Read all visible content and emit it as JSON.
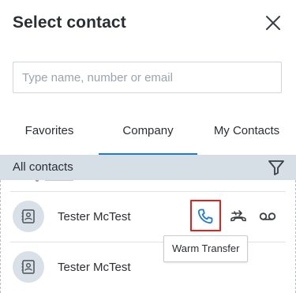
{
  "dialog": {
    "title": "Select contact"
  },
  "search": {
    "placeholder": "Type name, number or email",
    "value": ""
  },
  "tabs": [
    {
      "label": "Favorites",
      "active": false
    },
    {
      "label": "Company",
      "active": true
    },
    {
      "label": "My Contacts",
      "active": false
    }
  ],
  "section": {
    "label": "All contacts"
  },
  "contacts": [
    {
      "name": "Tester McTest",
      "avatar_icon": "contact-card-icon"
    },
    {
      "name": "Tester McTest",
      "avatar_icon": "contact-card-icon"
    }
  ],
  "actions": {
    "call_icon": "phone-icon",
    "transfer_icon": "transfer-icon",
    "voicemail_icon": "voicemail-icon"
  },
  "tooltip": {
    "text": "Warm Transfer"
  },
  "colors": {
    "accent": "#1f7ad6",
    "highlight": "#e1221c",
    "section_bg": "#d6dee6",
    "text": "#2b2f33"
  }
}
